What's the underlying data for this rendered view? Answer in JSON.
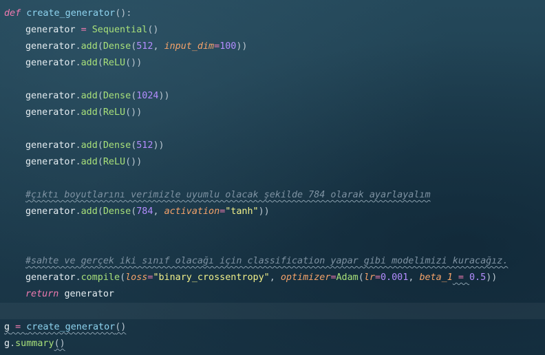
{
  "code": {
    "l1": {
      "kw": "def",
      "name": "create_generator",
      "punct": "():"
    },
    "l2": {
      "var": "generator",
      "op": "=",
      "cls": "Sequential",
      "p": "()"
    },
    "l3": {
      "var": "generator",
      "dot": ".",
      "meth": "add",
      "p1": "(",
      "cls": "Dense",
      "p2": "(",
      "n": "512",
      "comma": ",",
      "param": "input_dim",
      "eq": "=",
      "n2": "100",
      "p3": "))"
    },
    "l4": {
      "var": "generator",
      "dot": ".",
      "meth": "add",
      "p1": "(",
      "cls": "ReLU",
      "p2": "())"
    },
    "l6": {
      "var": "generator",
      "dot": ".",
      "meth": "add",
      "p1": "(",
      "cls": "Dense",
      "p2": "(",
      "n": "1024",
      "p3": "))"
    },
    "l7": {
      "var": "generator",
      "dot": ".",
      "meth": "add",
      "p1": "(",
      "cls": "ReLU",
      "p2": "())"
    },
    "l9": {
      "var": "generator",
      "dot": ".",
      "meth": "add",
      "p1": "(",
      "cls": "Dense",
      "p2": "(",
      "n": "512",
      "p3": "))"
    },
    "l10": {
      "var": "generator",
      "dot": ".",
      "meth": "add",
      "p1": "(",
      "cls": "ReLU",
      "p2": "())"
    },
    "l12": {
      "comment": "#çıktı boyutlarını verimizle uyumlu olacak şekilde 784 olarak ayarlayalım"
    },
    "l13": {
      "var": "generator",
      "dot": ".",
      "meth": "add",
      "p1": "(",
      "cls": "Dense",
      "p2": "(",
      "n": "784",
      "comma": ",",
      "param": "activation",
      "eq": "=",
      "str": "\"tanh\"",
      "p3": "))"
    },
    "l16": {
      "comment": "#sahte ve gerçek iki sınıf olacağı için classification yapar gibi modelimizi kuracağız."
    },
    "l17": {
      "var": "generator",
      "dot": ".",
      "meth": "compile",
      "p1": "(",
      "param1": "loss",
      "eq1": "=",
      "str1": "\"binary_crossentropy\"",
      "c1": ",",
      "param2": "optimizer",
      "eq2": "=",
      "cls": "Adam",
      "p2": "(",
      "param3": "lr",
      "eq3": "=",
      "n1": "0.001",
      "c2": ",",
      "param4": "beta_1",
      "eq4": " = ",
      "n2": "0.5",
      "p3": "))"
    },
    "l18": {
      "kw": "return",
      "var": "generator"
    },
    "l20": {
      "var": "g",
      "op": " = ",
      "fn": "create_generator",
      "p": "()"
    },
    "l21": {
      "var": "g",
      "dot": ".",
      "meth": "summary",
      "p": "()"
    }
  }
}
